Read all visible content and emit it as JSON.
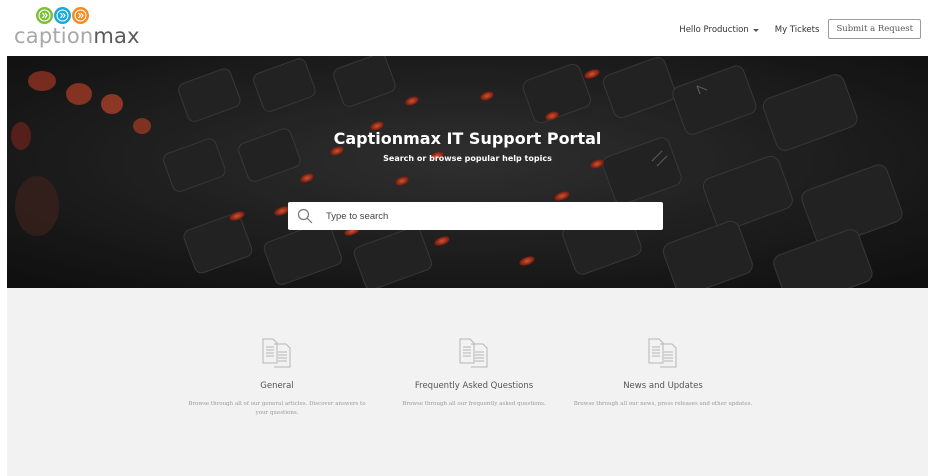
{
  "logo": {
    "text_light": "caption",
    "text_dark": "max",
    "colors": [
      "#7cbf3a",
      "#1aa8d8",
      "#f28c22"
    ]
  },
  "nav": {
    "user_menu": "Hello Production",
    "my_tickets": "My Tickets",
    "submit_request": "Submit a Request"
  },
  "hero": {
    "title": "Captionmax IT Support Portal",
    "subtitle": "Search or browse popular help topics",
    "search": {
      "placeholder": "Type to search",
      "value": ""
    }
  },
  "categories": [
    {
      "icon": "document-icon",
      "title": "General",
      "description": "Browse through all of our general articles. Discover answers to your questions."
    },
    {
      "icon": "document-icon",
      "title": "Frequently Asked Questions",
      "description": "Browse through all our frequently asked questions."
    },
    {
      "icon": "document-icon",
      "title": "News and Updates",
      "description": "Browse through all our news, press releases and other updates."
    }
  ]
}
